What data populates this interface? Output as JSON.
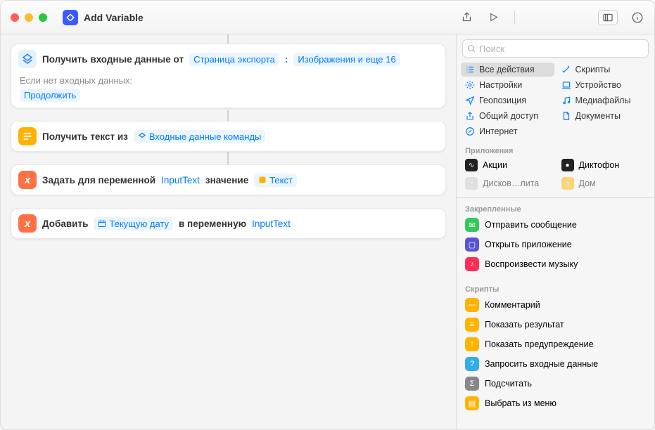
{
  "title": "Add Variable",
  "search": {
    "placeholder": "Поиск"
  },
  "card1": {
    "prefix": "Получить входные данные от",
    "chip1": "Страница экспорта",
    "chip2": "Изображения и еще 16",
    "no_input_label": "Если нет входных данных:",
    "continue": "Продолжить"
  },
  "card2": {
    "prefix": "Получить текст из",
    "chip": "Входные данные команды"
  },
  "card3": {
    "prefix": "Задать для переменной",
    "var": "InputText",
    "mid": "значение",
    "chip": "Текст"
  },
  "card4": {
    "prefix": "Добавить",
    "chip": "Текущую дату",
    "mid": "в переменную",
    "var": "InputText"
  },
  "cats_left": [
    {
      "label": "Все действия",
      "icon": "list"
    },
    {
      "label": "Настройки",
      "icon": "gear"
    },
    {
      "label": "Геопозиция",
      "icon": "nav"
    },
    {
      "label": "Общий доступ",
      "icon": "share"
    },
    {
      "label": "Интернет",
      "icon": "safari"
    }
  ],
  "cats_right": [
    {
      "label": "Скрипты",
      "icon": "wand"
    },
    {
      "label": "Устройство",
      "icon": "device"
    },
    {
      "label": "Медиафайлы",
      "icon": "music"
    },
    {
      "label": "Документы",
      "icon": "doc"
    }
  ],
  "apps_header": "Приложения",
  "apps": [
    {
      "label": "Акции",
      "color": "#222",
      "glyph": "∿"
    },
    {
      "label": "Диктофон",
      "color": "#222",
      "glyph": "●"
    },
    {
      "label": "Дисков…лита",
      "color": "#ccc",
      "glyph": "◔"
    },
    {
      "label": "Дом",
      "color": "#ffb300",
      "glyph": "⌂"
    }
  ],
  "pinned_header": "Закрепленные",
  "pinned": [
    {
      "label": "Отправить сообщение",
      "color": "green",
      "glyph": "✉"
    },
    {
      "label": "Открыть приложение",
      "color": "purple",
      "glyph": "▢"
    },
    {
      "label": "Воспроизвести музыку",
      "color": "red",
      "glyph": "♪"
    }
  ],
  "scripts_header": "Скрипты",
  "scripts": [
    {
      "label": "Комментарий",
      "color": "yellow",
      "glyph": "—"
    },
    {
      "label": "Показать результат",
      "color": "yellow",
      "glyph": "≡"
    },
    {
      "label": "Показать предупреждение",
      "color": "yellow",
      "glyph": "!"
    },
    {
      "label": "Запросить входные данные",
      "color": "cyan",
      "glyph": "?"
    },
    {
      "label": "Подсчитать",
      "color": "grey",
      "glyph": "Σ"
    },
    {
      "label": "Выбрать из меню",
      "color": "yellow",
      "glyph": "▤"
    }
  ]
}
